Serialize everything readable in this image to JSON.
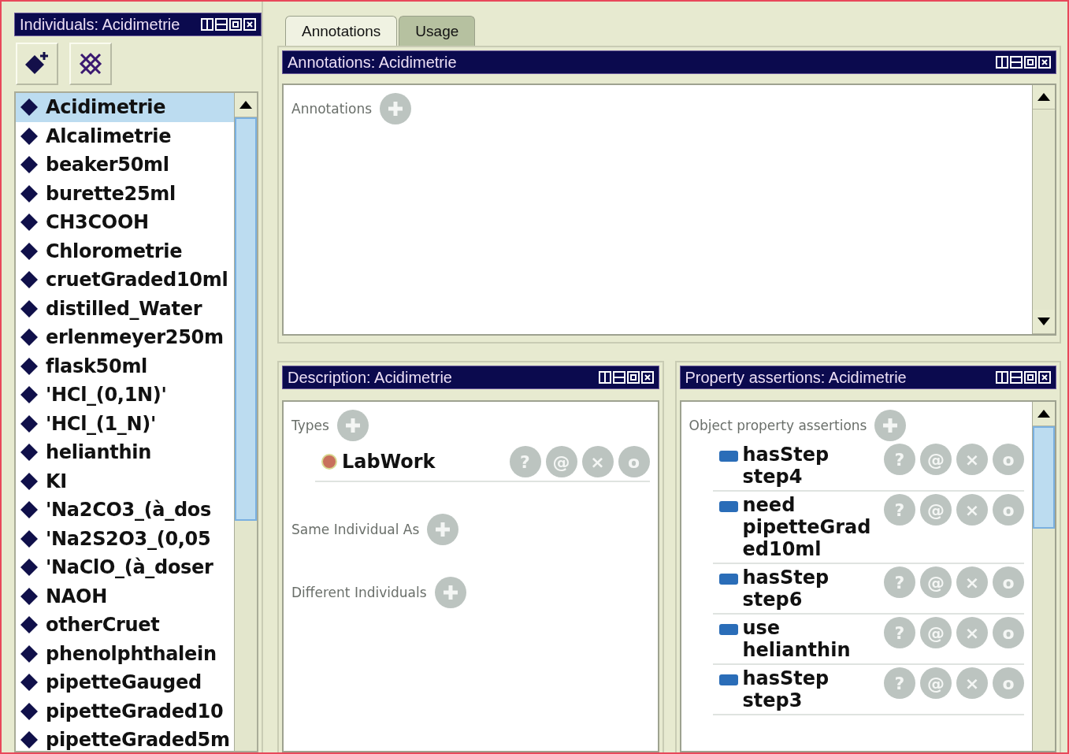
{
  "individuals_panel": {
    "title": "Individuals: Acidimetrie",
    "items": [
      {
        "label": "Acidimetrie",
        "selected": true
      },
      {
        "label": "Alcalimetrie",
        "selected": false
      },
      {
        "label": "beaker50ml",
        "selected": false
      },
      {
        "label": "burette25ml",
        "selected": false
      },
      {
        "label": "CH3COOH",
        "selected": false
      },
      {
        "label": "Chlorometrie",
        "selected": false
      },
      {
        "label": "cruetGraded10ml",
        "selected": false
      },
      {
        "label": "distilled_Water",
        "selected": false
      },
      {
        "label": "erlenmeyer250m",
        "selected": false
      },
      {
        "label": "flask50ml",
        "selected": false
      },
      {
        "label": "'HCl_(0,1N)'",
        "selected": false
      },
      {
        "label": "'HCl_(1_N)'",
        "selected": false
      },
      {
        "label": "helianthin",
        "selected": false
      },
      {
        "label": "KI",
        "selected": false
      },
      {
        "label": "'Na2CO3_(à_dos",
        "selected": false
      },
      {
        "label": "'Na2S2O3_(0,05",
        "selected": false
      },
      {
        "label": "'NaClO_(à_doser",
        "selected": false
      },
      {
        "label": "NAOH",
        "selected": false
      },
      {
        "label": "otherCruet",
        "selected": false
      },
      {
        "label": "phenolphthalein",
        "selected": false
      },
      {
        "label": "pipetteGauged",
        "selected": false
      },
      {
        "label": "pipetteGraded10",
        "selected": false
      },
      {
        "label": "pipetteGraded5m",
        "selected": false
      }
    ]
  },
  "tabs": [
    {
      "label": "Annotations",
      "selected": true
    },
    {
      "label": "Usage",
      "selected": false
    }
  ],
  "annotations_panel": {
    "title": "Annotations: Acidimetrie",
    "section": "Annotations"
  },
  "description_panel": {
    "title": "Description: Acidimetrie",
    "sections": [
      {
        "label": "Types",
        "entries": [
          {
            "name": "LabWork",
            "color": "#c8705c",
            "actions": [
              "?",
              "@",
              "×",
              "o"
            ]
          }
        ]
      },
      {
        "label": "Same Individual As"
      },
      {
        "label": "Different Individuals"
      }
    ]
  },
  "property_panel": {
    "title": "Property assertions: Acidimetrie",
    "section": "Object property assertions",
    "rows": [
      {
        "property": "hasStep",
        "value": "step4",
        "actions": [
          "?",
          "@",
          "×",
          "o"
        ]
      },
      {
        "property": "need",
        "value": "pipetteGraded10ml",
        "actions": [
          "?",
          "@",
          "×",
          "o"
        ]
      },
      {
        "property": "hasStep",
        "value": "step6",
        "actions": [
          "?",
          "@",
          "×",
          "o"
        ]
      },
      {
        "property": "use",
        "value": "helianthin",
        "actions": [
          "?",
          "@",
          "×",
          "o"
        ]
      },
      {
        "property": "hasStep",
        "value": "step3",
        "actions": [
          "?",
          "@",
          "×",
          "o"
        ]
      }
    ]
  }
}
